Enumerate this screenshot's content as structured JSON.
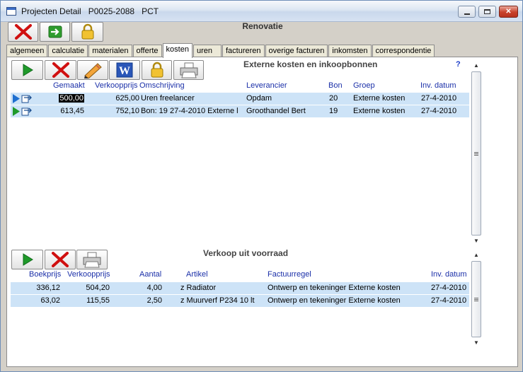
{
  "window": {
    "title": "Projecten Detail   P0025-2088   PCT",
    "icons": {
      "minimize": "minimize-icon",
      "maximize": "maximize-icon",
      "close": "close-x-icon"
    }
  },
  "top_toolbar": {
    "title": "Renovatie",
    "buttons": [
      "delete-cross-icon",
      "exit-arrow-icon",
      "lock-icon"
    ]
  },
  "tabs": [
    {
      "label": "algemeen"
    },
    {
      "label": "calculatie"
    },
    {
      "label": "materialen"
    },
    {
      "label": "offerte"
    },
    {
      "label": "kosten",
      "active": true
    },
    {
      "label": "uren"
    },
    {
      "label": "factureren"
    },
    {
      "label": "overige facturen"
    },
    {
      "label": "inkomsten"
    },
    {
      "label": "correspondentie"
    }
  ],
  "external_costs": {
    "title": "Externe kosten en inkoopbonnen",
    "help": "?",
    "toolbar_icons": [
      "play-icon",
      "delete-cross-icon",
      "pencil-icon",
      "word-icon",
      "lock-icon",
      "printer-icon"
    ],
    "columns": {
      "gemaakt": "Gemaakt",
      "verkoopprijs": "Verkoopprijs",
      "omschrijving": "Omschrijving",
      "leverancier": "Leverancier",
      "bon": "Bon",
      "groep": "Groep",
      "inv_datum": "Inv. datum"
    },
    "rows": [
      {
        "gemaakt": "500,00",
        "verkoopprijs": "625,00",
        "omschrijving": "Uren freelancer",
        "leverancier": "Opdam",
        "bon": "20",
        "groep": "Externe kosten",
        "inv_datum": "27-4-2010"
      },
      {
        "gemaakt": "613,45",
        "verkoopprijs": "752,10",
        "omschrijving": "Bon: 19 27-4-2010 Externe l",
        "leverancier": "Groothandel Bert",
        "bon": "19",
        "groep": "Externe kosten",
        "inv_datum": "27-4-2010"
      }
    ]
  },
  "stock_sales": {
    "title": "Verkoop uit voorraad",
    "toolbar_icons": [
      "play-icon",
      "delete-cross-icon",
      "printer-icon"
    ],
    "columns": {
      "boekprijs": "Boekprijs",
      "verkoopprijs": "Verkoopprijs",
      "aantal": "Aantal",
      "artikel": "Artikel",
      "factuurregel": "Factuurregel",
      "inv_datum": "Inv. datum"
    },
    "rows": [
      {
        "boekprijs": "336,12",
        "verkoopprijs": "504,20",
        "aantal": "4,00",
        "artikel": "z Radiator",
        "factuurregel": "Ontwerp en tekeninger Externe kosten",
        "inv_datum": "27-4-2010"
      },
      {
        "boekprijs": "63,02",
        "verkoopprijs": "115,55",
        "aantal": "2,50",
        "artikel": "z Muurverf P234 10 lt",
        "factuurregel": "Ontwerp en tekeninger Externe kosten",
        "inv_datum": "27-4-2010"
      }
    ]
  },
  "colors": {
    "row_highlight": "#cde3f7",
    "header_text": "#1a2fa8",
    "close_red": "#c8402a"
  }
}
